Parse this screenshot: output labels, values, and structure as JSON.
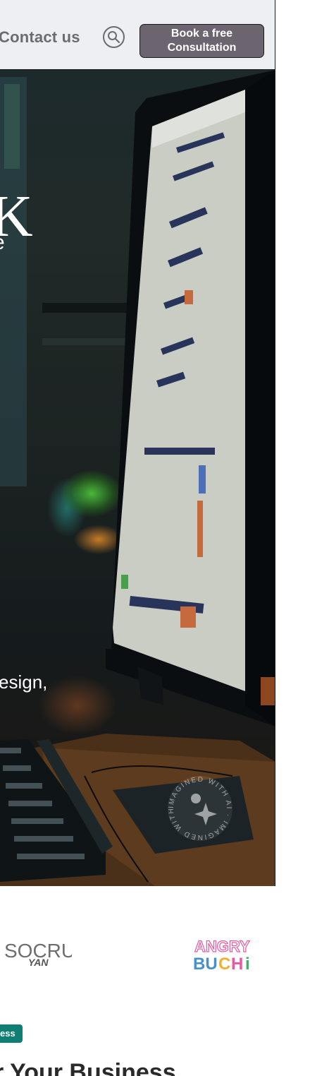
{
  "header": {
    "contact_label": "Contact us",
    "search_icon": "search-icon",
    "cta_line1": "Book a free",
    "cta_line2": "Consultation"
  },
  "hero": {
    "title_glyph": "K",
    "title_line2": "e",
    "description": "esign,",
    "watermark_text": "IMAGINED WITH AI"
  },
  "logos": {
    "socru": "SOCRU",
    "socru_sub": "YAN",
    "angry_top": "ANGRY",
    "angry_bottom": "BUCHi"
  },
  "section": {
    "badge": "ess",
    "heading": "r Your Business"
  },
  "colors": {
    "header_bg": "#eeeff3",
    "cta_bg": "#6c6570",
    "badge_bg": "#0f7f74",
    "hero_dark": "#1c2322"
  }
}
